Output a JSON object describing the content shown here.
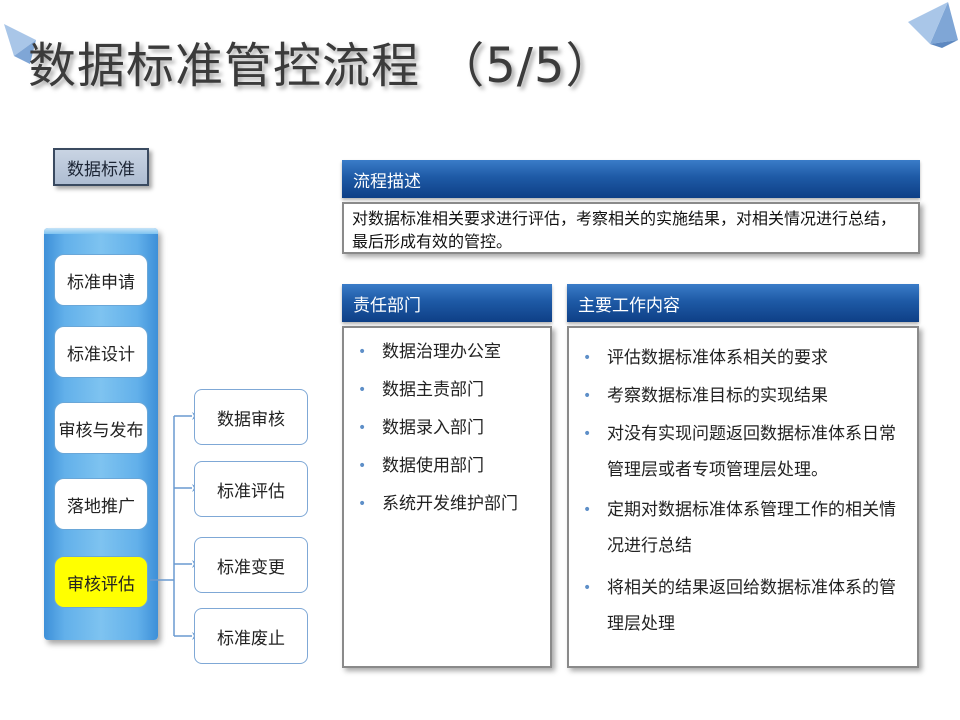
{
  "title": "数据标准管控流程 （5/5）",
  "category_label": "数据标准",
  "steps": [
    {
      "label": "标准申请"
    },
    {
      "label": "标准设计"
    },
    {
      "label": "审核与发布"
    },
    {
      "label": "落地推广"
    },
    {
      "label": "审核评估",
      "active": true
    }
  ],
  "substeps": [
    {
      "label": "数据审核"
    },
    {
      "label": "标准评估"
    },
    {
      "label": "标准变更"
    },
    {
      "label": "标准废止"
    }
  ],
  "description": {
    "header": "流程描述",
    "text": "对数据标准相关要求进行评估，考察相关的实施结果，对相关情况进行总结，最后形成有效的管控。"
  },
  "departments": {
    "header": "责任部门",
    "items": [
      "数据治理办公室",
      "数据主责部门",
      "数据录入部门",
      "数据使用部门",
      "系统开发维护部门"
    ]
  },
  "work": {
    "header": "主要工作内容",
    "items": [
      "评估数据标准体系相关的要求",
      "考察数据标准目标的实现结果",
      "对没有实现问题返回数据标准体系日常管理层或者专项管理层处理。",
      "定期对数据标准体系管理工作的相关情况进行总结",
      "将相关的结果返回给数据标准体系的管理层处理"
    ]
  },
  "colors": {
    "header_blue": "#1e5aa6",
    "active_step": "#ffff00",
    "steps_panel": "#62b0ea"
  }
}
